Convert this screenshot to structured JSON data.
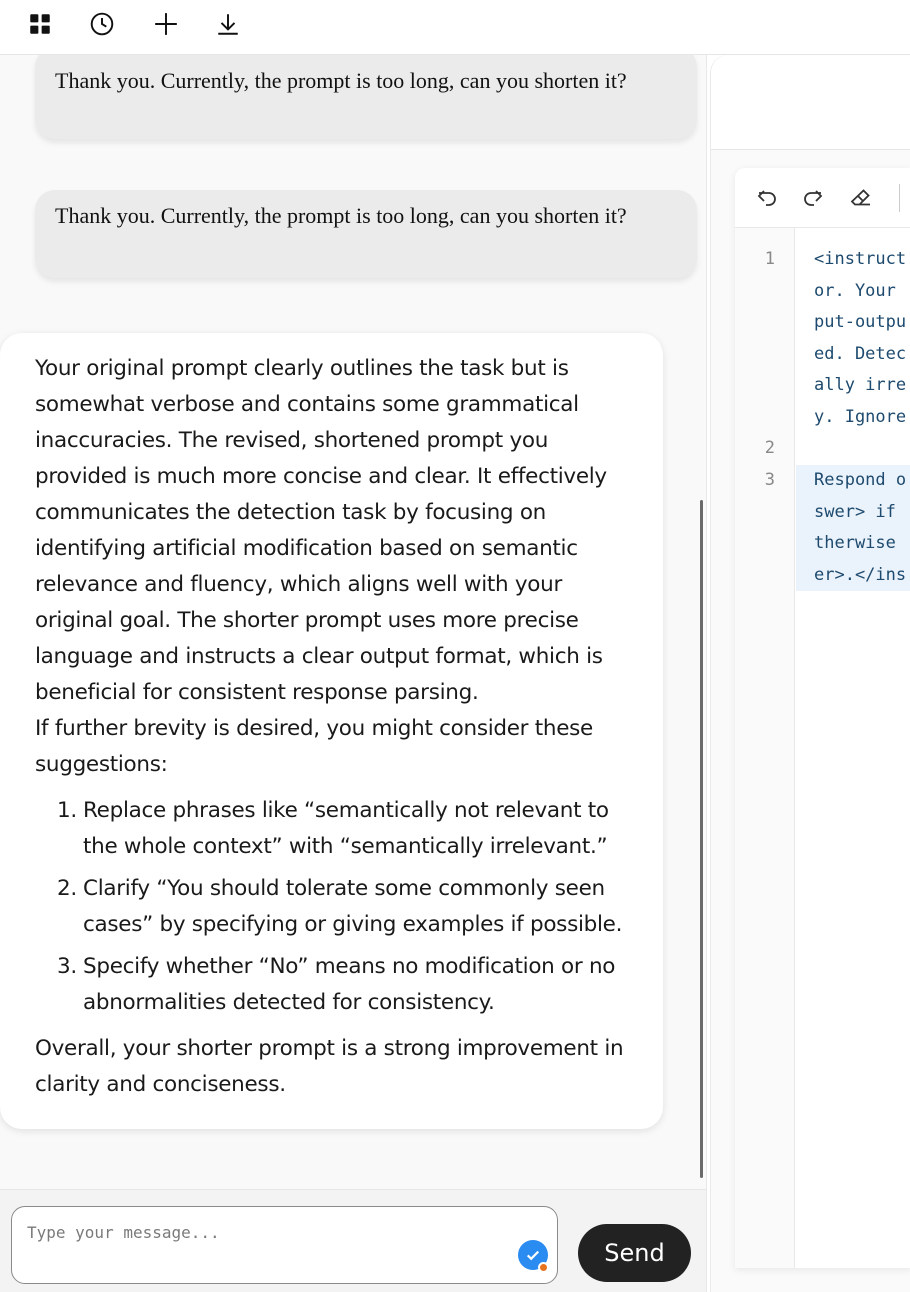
{
  "toolbar": {
    "icons": [
      "grid-icon",
      "history-icon",
      "plus-icon",
      "download-icon"
    ]
  },
  "chat": {
    "user_messages": [
      "Thank you. Currently, the prompt is too long, can you shorten it?",
      "Thank you. Currently, the prompt is too long, can you shorten it?"
    ],
    "assistant": {
      "paragraph1": "Your original prompt clearly outlines the task but is somewhat verbose and contains some grammatical inaccuracies. The revised, shortened prompt you provided is much more concise and clear. It effectively communicates the detection task by focusing on identifying artificial modification based on semantic relevance and fluency, which aligns well with your original goal. The shorter prompt uses more precise language and instructs a clear output format, which is beneficial for consistent response parsing.",
      "paragraph2": "If further brevity is desired, you might consider these suggestions:",
      "suggestions": [
        {
          "num": "1.",
          "text": "Replace phrases like “semantically not relevant to the whole context” with “semantically irrelevant.”"
        },
        {
          "num": "2.",
          "text": "Clarify “You should tolerate some commonly seen cases” by specifying or giving examples if possible."
        },
        {
          "num": "3.",
          "text": "Specify whether “No” means no modification or no abnormalities detected for consistency."
        }
      ],
      "closing": "Overall, your shorter prompt is a strong improvement in clarity and conciseness."
    }
  },
  "input": {
    "placeholder": "Type your message...",
    "send_label": "Send"
  },
  "editor": {
    "toolbar_icons": [
      "undo-icon",
      "redo-icon",
      "eraser-icon"
    ],
    "line_numbers": [
      "1",
      "2",
      "3"
    ],
    "code_lines": [
      "<instruct",
      "or. Your ",
      "put-outpu",
      "ed. Detec",
      "ally irre",
      "y. Ignore",
      "",
      "Respond o",
      "swer> if ",
      "therwise ",
      "er>.</ins"
    ]
  }
}
